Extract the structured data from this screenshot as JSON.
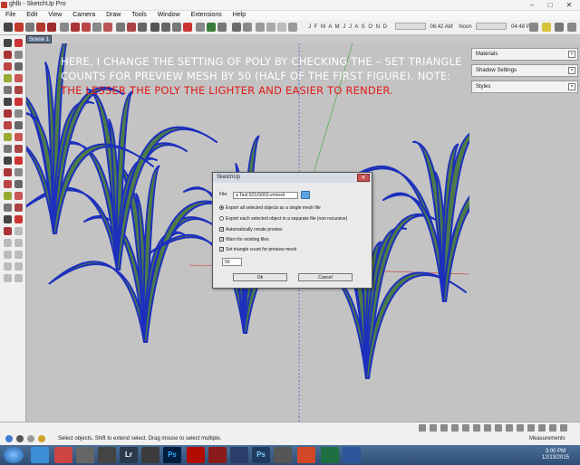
{
  "window": {
    "title": "ghlb - SketchUp Pro",
    "minimize": "–",
    "maximize": "□",
    "close": "✕"
  },
  "menu": [
    "File",
    "Edit",
    "View",
    "Camera",
    "Draw",
    "Tools",
    "Window",
    "Extensions",
    "Help"
  ],
  "toolbar": {
    "shadow_months": "J F M A M J J A S O N D",
    "shadow_time_start": "06:42 AM",
    "shadow_noon": "Noon",
    "shadow_time_end": "04:48 PM"
  },
  "scene_tab": "Scene 1",
  "annotation": {
    "white_text": "HERE, I CHANGE THE SETTING OF POLY BY CHECKING THE – SET TRIANGLE COUNTS FOR PREVIEW MESH BY 50 (HALF OF THE FIRST FIGURE). NOTE: ",
    "red_text": "THE LESSER THE POLY THE LIGHTER AND EASIER TO RENDER."
  },
  "trays": [
    "Materials",
    "Shadow Settings",
    "Styles"
  ],
  "dialog": {
    "title": "SketchUp",
    "file_label": "File:",
    "file_value": "a Test 021/G003.vrmesh",
    "option_single": "Export all selected objects as a single mesh file",
    "option_separate": "Export each selected object in a separate file (non recursive)",
    "auto_proxies": "Automatically create proxies",
    "warn_existing": "Warn for existing files",
    "set_triangle": "Set triangle count for preview mesh",
    "triangle_count": "50",
    "ok_label": "Ok",
    "cancel_label": "Cancel"
  },
  "status": {
    "message": "Select objects. Shift to extend select. Drag mouse to select multiple.",
    "measurements": "Measurements"
  },
  "taskbar": {
    "time": "3:00 PM",
    "date": "12/13/2015"
  },
  "colors": {
    "grass_fill": "#4d7a4a",
    "grass_edge": "#1c2fbd",
    "viewport_bg": "#c3c3c3",
    "annotation_red": "#e21a1a"
  }
}
